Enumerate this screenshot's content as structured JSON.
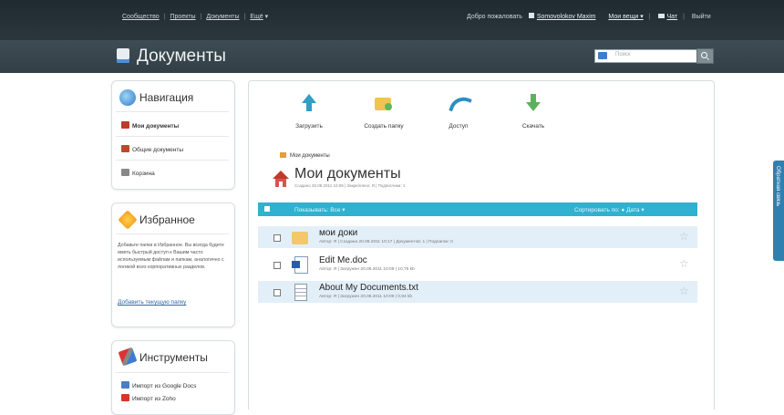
{
  "topbar": {
    "links": [
      "Сообщество",
      "Проекты",
      "Документы",
      "Ещё"
    ],
    "more_caret": "▾",
    "welcome": "Добро пожаловать",
    "user": "Somovolokov Maxim",
    "my_items": "Мои вещи ▾",
    "chat": "Чат",
    "logout": "Выйти"
  },
  "header": {
    "title": "Документы",
    "search_placeholder": "Поиск"
  },
  "sidebar": {
    "nav": {
      "title": "Навигация",
      "items": [
        {
          "label": "Мои документы",
          "icon": "home-icon",
          "color": "#c0392b"
        },
        {
          "label": "Общие документы",
          "icon": "shared-folder-icon",
          "color": "#b94a2c"
        },
        {
          "label": "Корзина",
          "icon": "trash-icon",
          "color": "#888888"
        }
      ]
    },
    "favorites": {
      "title": "Избранное",
      "text": "Добавьте папки в Избранное. Вы всегда будете иметь быстрый доступ к Вашим часто используемым файлам и папкам, аналогично с логикой всех корпоративных разделов.",
      "link": "Добавить текущую папку"
    },
    "tools": {
      "title": "Инструменты",
      "items": [
        {
          "label": "Импорт из Google Docs",
          "icon": "google-docs-icon",
          "color": "#4a7fc0"
        },
        {
          "label": "Импорт из Zoho",
          "icon": "zoho-icon",
          "color": "#d9342b"
        }
      ]
    }
  },
  "actions": [
    {
      "label": "Загрузить",
      "icon": "upload-icon"
    },
    {
      "label": "Создать папку",
      "icon": "new-folder-icon"
    },
    {
      "label": "Доступ",
      "icon": "share-icon"
    },
    {
      "label": "Скачать",
      "icon": "download-icon"
    }
  ],
  "breadcrumb": "Мои документы",
  "page": {
    "title": "Мои документы",
    "meta": "Создано 20.08.2011 10:09 | Закреплено: Я | Подписчики: 1"
  },
  "listbar": {
    "show": "Показывать: Все ▾",
    "sort": "Сортировать по: ● Дата ▾"
  },
  "rows": [
    {
      "name": "мои доки",
      "meta": "Автор: Я | Создана 20.08.2011 10:17 | Документов: 1 | Подпапок: 0",
      "icon": "folder-icon",
      "highlight": true
    },
    {
      "name": "Edit Me.doc",
      "meta": "Автор: Я | Загружен 20.08.2011 10:09 | 10,75 kb",
      "icon": "word-doc-icon",
      "highlight": false
    },
    {
      "name": "About My Documents.txt",
      "meta": "Автор: Я | Загружен 20.08.2011 10:09 | 0,94 kb",
      "icon": "text-file-icon",
      "highlight": true
    }
  ],
  "side_tab": "Обратная связь",
  "colors": {
    "accent": "#2fb1cf",
    "topbar": "#232e34",
    "header": "#38454c",
    "row_highlight": "#e3eff8"
  }
}
